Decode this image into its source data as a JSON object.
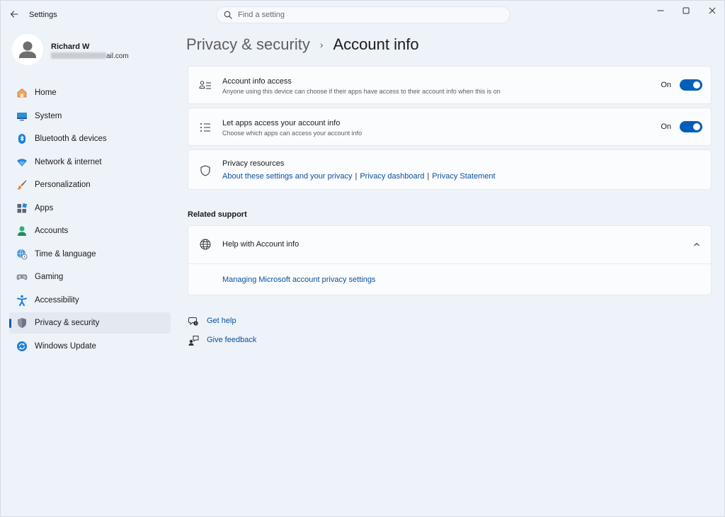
{
  "window": {
    "title": "Settings",
    "search_placeholder": "Find a setting",
    "controls": {
      "minimize": "minimize-icon",
      "maximize": "maximize-icon",
      "close": "close-icon"
    }
  },
  "profile": {
    "name": "Richard W",
    "email_visible_suffix": "ail.com"
  },
  "sidebar": {
    "items": [
      {
        "label": "Home",
        "icon": "home-icon"
      },
      {
        "label": "System",
        "icon": "system-icon"
      },
      {
        "label": "Bluetooth & devices",
        "icon": "bluetooth-icon"
      },
      {
        "label": "Network & internet",
        "icon": "wifi-icon"
      },
      {
        "label": "Personalization",
        "icon": "brush-icon"
      },
      {
        "label": "Apps",
        "icon": "apps-icon"
      },
      {
        "label": "Accounts",
        "icon": "accounts-icon"
      },
      {
        "label": "Time & language",
        "icon": "globe-clock-icon"
      },
      {
        "label": "Gaming",
        "icon": "gamepad-icon"
      },
      {
        "label": "Accessibility",
        "icon": "accessibility-icon"
      },
      {
        "label": "Privacy & security",
        "icon": "shield-icon",
        "active": true
      },
      {
        "label": "Windows Update",
        "icon": "update-icon"
      }
    ]
  },
  "breadcrumb": {
    "parent": "Privacy & security",
    "separator": "›",
    "current": "Account info"
  },
  "settings": {
    "account_info_access": {
      "title": "Account info access",
      "description": "Anyone using this device can choose if their apps have access to their account info when this is on",
      "state": "On"
    },
    "let_apps_access": {
      "title": "Let apps access your account info",
      "description": "Choose which apps can access your account info",
      "state": "On"
    },
    "privacy_resources": {
      "title": "Privacy resources",
      "links": [
        "About these settings and your privacy",
        "Privacy dashboard",
        "Privacy Statement"
      ],
      "separator": "|"
    }
  },
  "related_support": {
    "heading": "Related support",
    "help_title": "Help with Account info",
    "help_link": "Managing Microsoft account privacy settings"
  },
  "footer_links": {
    "get_help": "Get help",
    "give_feedback": "Give feedback"
  },
  "colors": {
    "accent": "#005fb8",
    "link": "#0a4fa0",
    "background": "#eef2f9",
    "card": "#fbfcfe"
  }
}
